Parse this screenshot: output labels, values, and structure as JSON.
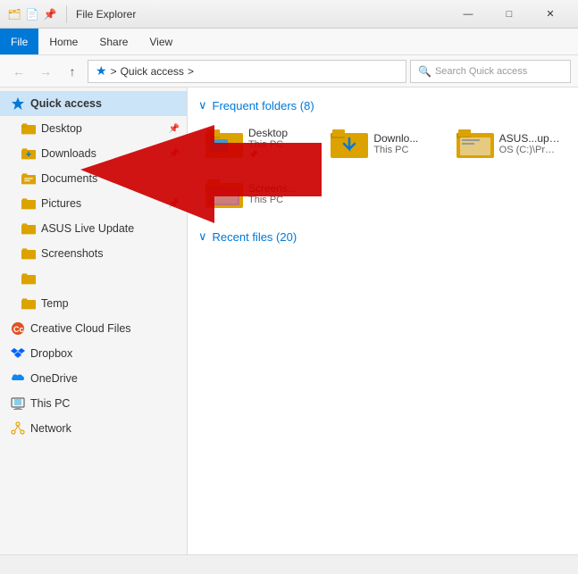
{
  "titleBar": {
    "title": "File Explorer",
    "icons": [
      "folder-icon",
      "document-icon",
      "pin-icon"
    ],
    "winMin": "—",
    "winMax": "□",
    "winClose": "✕"
  },
  "menuBar": {
    "items": [
      {
        "label": "File",
        "active": true
      },
      {
        "label": "Home",
        "active": false
      },
      {
        "label": "Share",
        "active": false
      },
      {
        "label": "View",
        "active": false
      }
    ]
  },
  "addressBar": {
    "back": "←",
    "forward": "→",
    "up": "↑",
    "pathParts": [
      "★",
      ">",
      "Quick access",
      ">"
    ],
    "searchPlaceholder": "Search Quick access"
  },
  "sidebar": {
    "items": [
      {
        "id": "quick-access",
        "label": "Quick access",
        "icon": "star",
        "active": true,
        "type": "header"
      },
      {
        "id": "desktop",
        "label": "Desktop",
        "icon": "folder-desktop",
        "pin": true
      },
      {
        "id": "downloads",
        "label": "Downloads",
        "icon": "folder-downloads",
        "pin": true
      },
      {
        "id": "documents",
        "label": "Documents",
        "icon": "folder-documents",
        "pin": false
      },
      {
        "id": "pictures",
        "label": "Pictures",
        "icon": "folder-pictures",
        "pin": true
      },
      {
        "id": "asus-live-update",
        "label": "ASUS Live Update",
        "icon": "folder-yellow"
      },
      {
        "id": "screenshots",
        "label": "Screenshots",
        "icon": "folder-yellow"
      },
      {
        "id": "unnamed",
        "label": "",
        "icon": "folder-yellow"
      },
      {
        "id": "temp",
        "label": "Temp",
        "icon": "folder-yellow"
      },
      {
        "id": "creative-cloud",
        "label": "Creative Cloud Files",
        "icon": "cc"
      },
      {
        "id": "dropbox",
        "label": "Dropbox",
        "icon": "dropbox"
      },
      {
        "id": "onedrive",
        "label": "OneDrive",
        "icon": "onedrive"
      },
      {
        "id": "this-pc",
        "label": "This PC",
        "icon": "thispc"
      },
      {
        "id": "network",
        "label": "Network",
        "icon": "network"
      }
    ]
  },
  "content": {
    "frequentFolders": {
      "label": "Frequent folders",
      "count": 8,
      "items": [
        {
          "name": "Desktop",
          "sub": "This PC",
          "pin": true,
          "type": "desktop"
        },
        {
          "name": "Downlo...",
          "sub": "This PC",
          "pin": false,
          "type": "downloads"
        },
        {
          "name": "ASUS...update",
          "sub": "OS (C:)\\ProgramData\\ASUS",
          "pin": false,
          "type": "asus"
        },
        {
          "name": "Screens...",
          "sub": "This PC",
          "pin": false,
          "type": "screenshots"
        }
      ]
    },
    "recentFiles": {
      "label": "Recent files",
      "count": 20
    }
  },
  "statusBar": {
    "text": ""
  }
}
